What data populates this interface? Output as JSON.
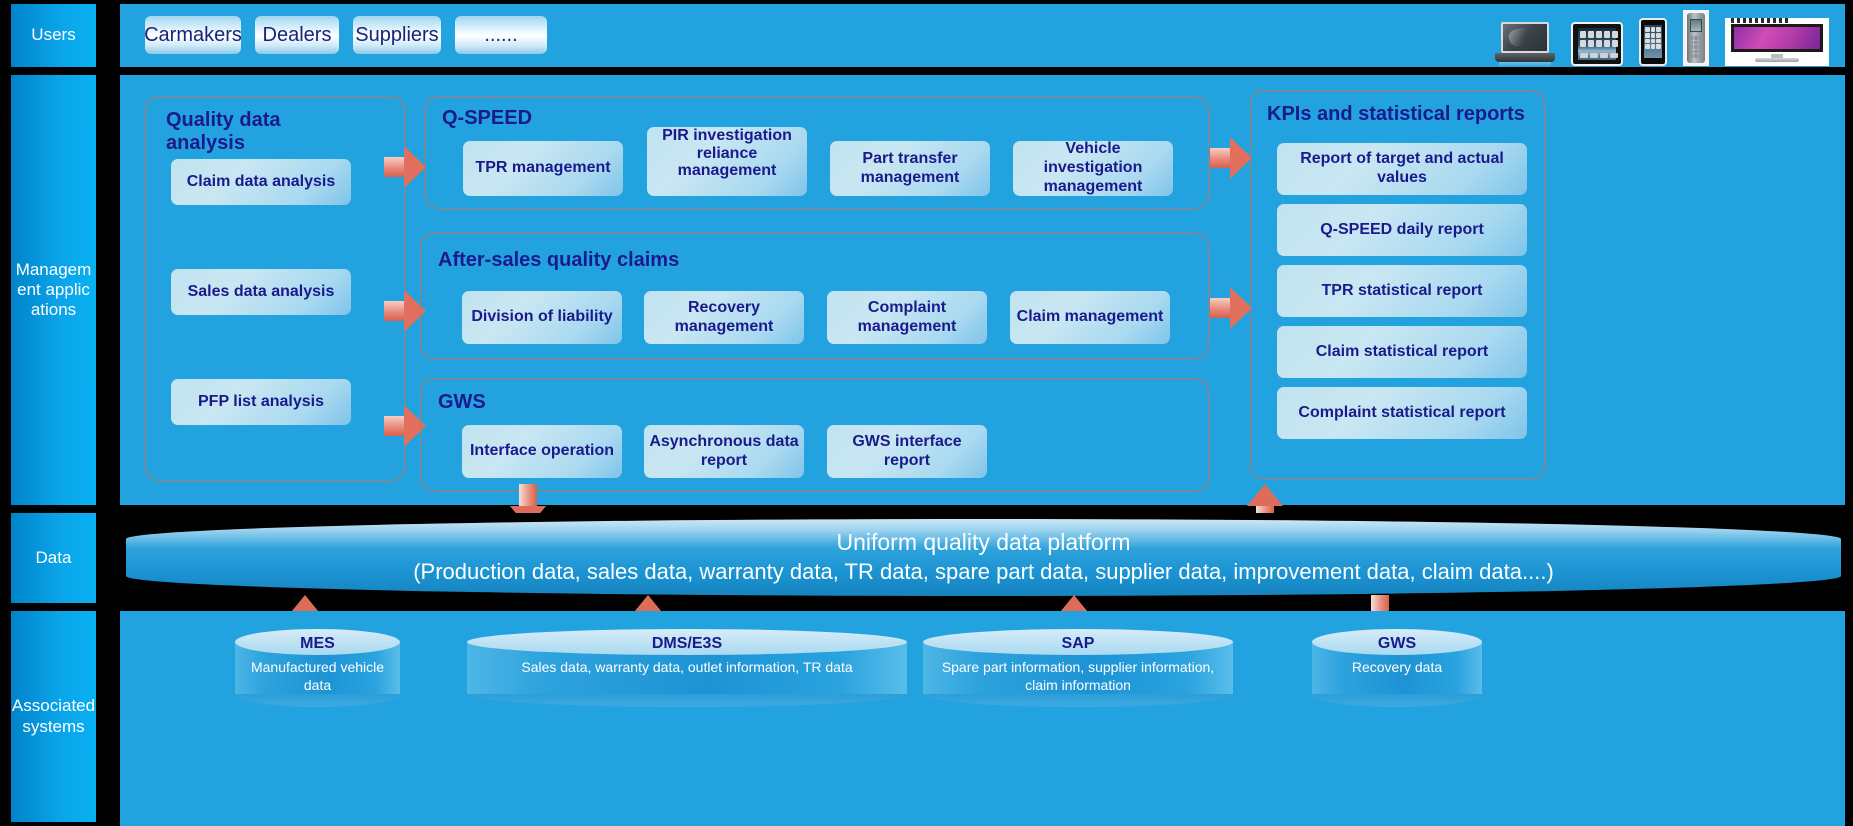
{
  "sidebar": {
    "rows": [
      {
        "label": "Users"
      },
      {
        "label": "Management applications"
      },
      {
        "label": "Data"
      },
      {
        "label": "Associated systems"
      }
    ]
  },
  "users_row": {
    "tabs": [
      {
        "label": "Carmakers"
      },
      {
        "label": "Dealers"
      },
      {
        "label": "Suppliers"
      },
      {
        "label": "......"
      }
    ],
    "devices": [
      {
        "name": "laptop-device-icon"
      },
      {
        "name": "tablet-device-icon"
      },
      {
        "name": "smartphone-device-icon"
      },
      {
        "name": "handheld-scanner-device-icon"
      },
      {
        "name": "widescreen-monitor-device-icon"
      }
    ]
  },
  "applications": {
    "analysis_group": {
      "title": "Quality data analysis",
      "items": [
        {
          "label": "Claim data analysis"
        },
        {
          "label": "Sales data analysis"
        },
        {
          "label": "PFP list analysis"
        }
      ]
    },
    "groups": [
      {
        "title": "Q-SPEED",
        "items": [
          {
            "label": "TPR management"
          },
          {
            "label": "PIR investigation reliance management"
          },
          {
            "label": "Part transfer management"
          },
          {
            "label": "Vehicle investigation management"
          }
        ]
      },
      {
        "title": "After-sales quality claims",
        "items": [
          {
            "label": "Division of liability"
          },
          {
            "label": "Recovery management"
          },
          {
            "label": "Complaint management"
          },
          {
            "label": "Claim management"
          }
        ]
      },
      {
        "title": "GWS",
        "items": [
          {
            "label": "Interface operation"
          },
          {
            "label": "Asynchronous data report"
          },
          {
            "label": "GWS interface report"
          }
        ]
      }
    ],
    "kpi_group": {
      "title": "KPIs and statistical reports",
      "items": [
        {
          "label": "Report of target and actual values"
        },
        {
          "label": "Q-SPEED daily report"
        },
        {
          "label": "TPR statistical report"
        },
        {
          "label": "Claim statistical report"
        },
        {
          "label": "Complaint statistical report"
        }
      ]
    }
  },
  "data_layer": {
    "line1": "Uniform quality data platform",
    "line2": "(Production data, sales data, warranty data, TR data, spare part data, supplier data, improvement data, claim data....)"
  },
  "associated_systems": [
    {
      "name": "MES",
      "desc": "Manufactured vehicle data"
    },
    {
      "name": "DMS/E3S",
      "desc": "Sales data, warranty data, outlet information, TR data"
    },
    {
      "name": "SAP",
      "desc": "Spare part information, supplier information, claim information"
    },
    {
      "name": "GWS",
      "desc": "Recovery data"
    }
  ],
  "colors": {
    "panel_blue": "#22a3e0",
    "sidebar_blue": "#0aa3e8",
    "chip_blue": "#bfe3ef",
    "title_navy": "#1a1a8c",
    "arrow_salmon": "#e0705d",
    "group_border": "#b8775e",
    "background": "#000000"
  }
}
